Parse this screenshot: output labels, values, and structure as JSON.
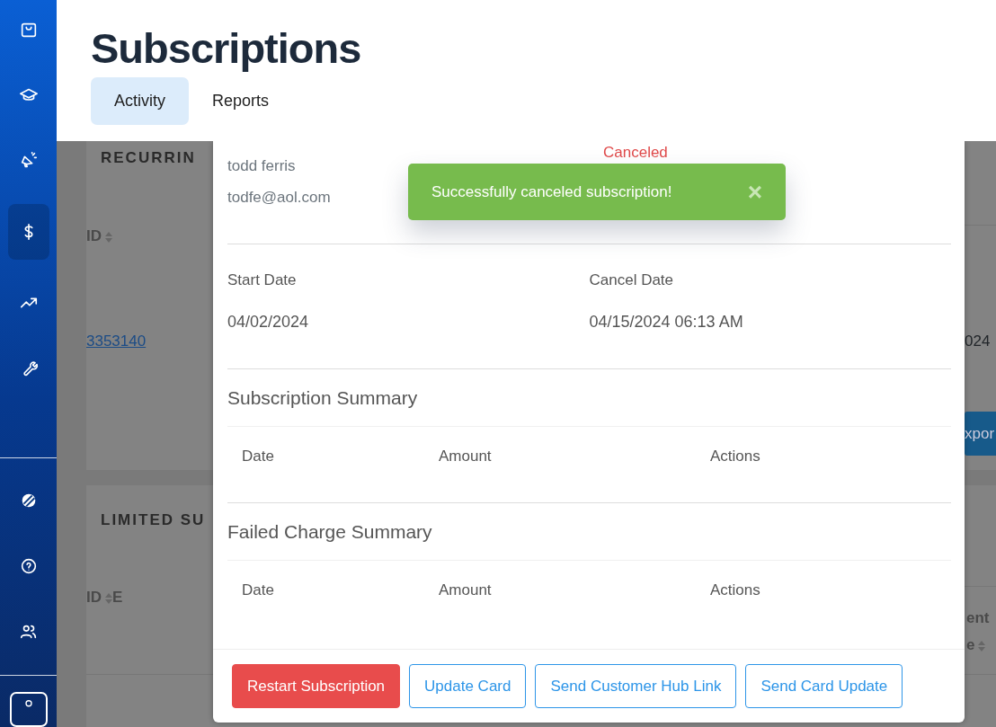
{
  "sidebar": {
    "top_items": [
      {
        "kind": "bag",
        "selected": false
      },
      {
        "kind": "cap",
        "selected": false
      },
      {
        "kind": "megaphone",
        "selected": false
      },
      {
        "kind": "dollar",
        "selected": true
      },
      {
        "kind": "trend",
        "selected": false
      },
      {
        "kind": "wrench",
        "selected": false
      }
    ],
    "bottom_items": [
      {
        "kind": "ball",
        "selected": false
      },
      {
        "kind": "help",
        "selected": false
      },
      {
        "kind": "users",
        "selected": false
      }
    ],
    "account_item": {
      "kind": "user"
    }
  },
  "page": {
    "title": "Subscriptions",
    "tabs": [
      {
        "label": "Activity",
        "selected": true
      },
      {
        "label": "Reports",
        "selected": false
      }
    ]
  },
  "background": {
    "recurring_card": {
      "title": "RECURRIN",
      "id_header": "ID",
      "row_id": "3353140",
      "right_cell": "024",
      "export_button": "xpor"
    },
    "limited_card": {
      "title": "LIMITED SU",
      "id_header": "ID",
      "column_2_header": "E",
      "right_header_line_1": "ent",
      "right_header_line_2": "e"
    }
  },
  "modal": {
    "customer_name": "todd ferris",
    "customer_email": "todfe@aol.com",
    "status": "Canceled",
    "start_date_label": "Start Date",
    "start_date": "04/02/2024",
    "cancel_date_label": "Cancel Date",
    "cancel_date": "04/15/2024 06:13 AM",
    "sections": [
      {
        "title": "Subscription Summary",
        "columns": [
          "Date",
          "Amount",
          "Actions"
        ]
      },
      {
        "title": "Failed Charge Summary",
        "columns": [
          "Date",
          "Amount",
          "Actions"
        ]
      }
    ],
    "buttons": [
      {
        "label": "Restart Subscription",
        "kind": "danger"
      },
      {
        "label": "Update Card",
        "kind": "outline"
      },
      {
        "label": "Send Customer Hub Link",
        "kind": "outline"
      },
      {
        "label": "Send Card Update",
        "kind": "outline"
      }
    ]
  },
  "toast": {
    "message": "Successfully canceled subscription!",
    "close": "×"
  }
}
